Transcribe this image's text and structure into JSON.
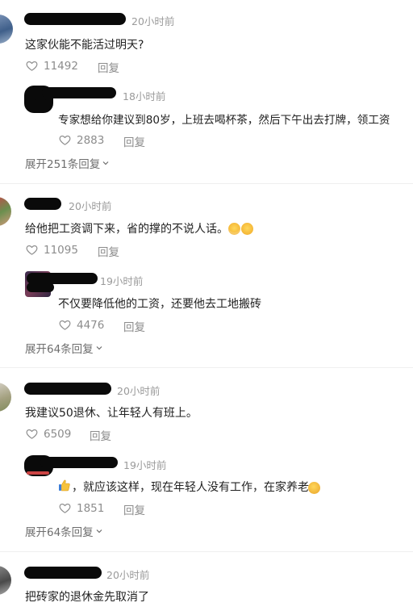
{
  "threads": [
    {
      "comment": {
        "time": "20小时前",
        "text": "这家伙能不能活过明天?",
        "likes": "11492",
        "reply_label": "回复"
      },
      "reply": {
        "time": "18小时前",
        "text": "专家想给你建议到80岁，上班去喝杯茶，然后下午出去打牌，领工资",
        "likes": "2883",
        "reply_label": "回复"
      },
      "expand_label": "展开251条回复"
    },
    {
      "comment": {
        "time": "20小时前",
        "text": "给他把工资调下来，省的撑的不说人话。",
        "likes": "11095",
        "reply_label": "回复"
      },
      "reply": {
        "time": "19小时前",
        "text": "不仅要降低他的工资，还要他去工地搬砖",
        "likes": "4476",
        "reply_label": "回复"
      },
      "expand_label": "展开64条回复"
    },
    {
      "comment": {
        "time": "20小时前",
        "text": "我建议50退休、让年轻人有班上。",
        "likes": "6509",
        "reply_label": "回复"
      },
      "reply": {
        "time": "19小时前",
        "text": "，就应该这样，现在年轻人没有工作，在家养老",
        "likes": "1851",
        "reply_label": "回复"
      },
      "expand_label": "展开64条回复"
    },
    {
      "comment": {
        "time": "20小时前",
        "text": "把砖家的退休金先取消了"
      }
    }
  ],
  "icons": {
    "like": "heart-outline-icon",
    "expand": "chevron-down-icon",
    "emoji_grin": "grinning-emoji-icon",
    "emoji_thumb": "thumbs-up-emoji-icon",
    "emoji_cover": "face-covering-emoji-icon"
  },
  "colors": {
    "meta_text": "#9a9a9a",
    "icon_gray": "#8c8c8c",
    "body_text": "#222222"
  }
}
